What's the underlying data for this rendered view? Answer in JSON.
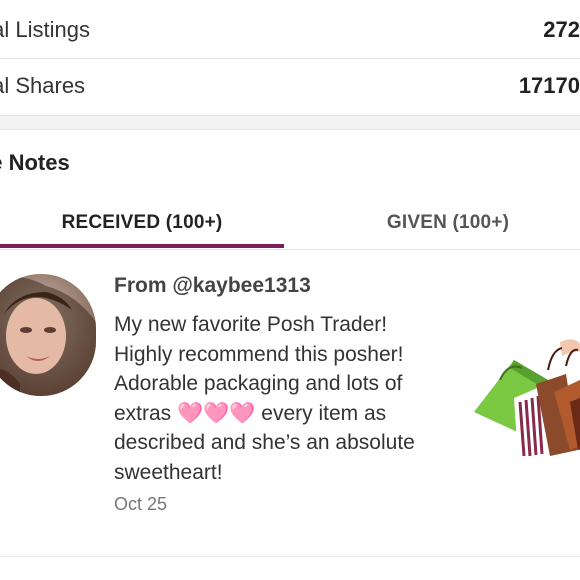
{
  "stats": {
    "listings": {
      "label": "tal Listings",
      "value": "272"
    },
    "shares": {
      "label": "tal Shares",
      "value": "17170"
    }
  },
  "love_notes": {
    "title": "ve Notes",
    "tabs": {
      "received": "RECEIVED (100+)",
      "given": "GIVEN (100+)"
    },
    "note": {
      "from": "From @kaybee1313",
      "body": "My new favorite Posh Trader! Highly recommend this posher! Adorable packaging and lots of extras 🩷🩷🩷 every item as described and she’s an absolute sweetheart!",
      "date": "Oct 25"
    }
  },
  "colors": {
    "accent": "#7b1d5a",
    "divider": "#e6e6e6",
    "gap": "#f3f3f3"
  },
  "icons": {
    "avatar": "user-avatar",
    "shopping": "shopping-bags-icon"
  }
}
